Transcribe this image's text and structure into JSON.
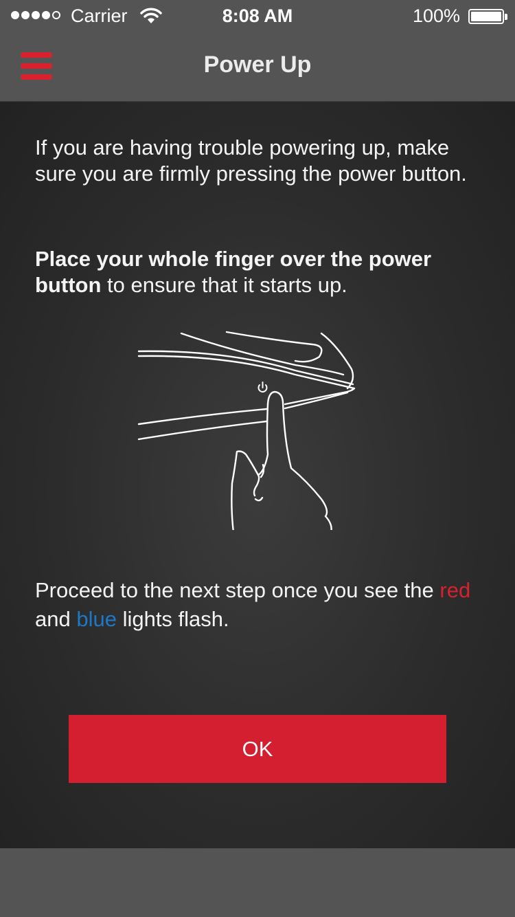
{
  "status_bar": {
    "carrier": "Carrier",
    "time": "8:08 AM",
    "battery_percent": "100%",
    "signal_bars_filled": 4,
    "signal_bars_total": 5,
    "icons": [
      "signal-icon",
      "wifi-icon",
      "battery-icon"
    ]
  },
  "nav": {
    "title": "Power Up",
    "menu_icon": "hamburger-menu-icon"
  },
  "content": {
    "paragraph1": "If you are having trouble powering up, make sure you are firmly pressing the power button.",
    "paragraph2_bold": "Place your whole finger over the power button",
    "paragraph2_rest": " to ensure that it starts up.",
    "illustration": "finger-pressing-power-button-illustration",
    "paragraph3_start": "Proceed to the next step once you see the ",
    "paragraph3_red": "red",
    "paragraph3_mid": " and ",
    "paragraph3_blue": "blue",
    "paragraph3_end": " lights flash."
  },
  "actions": {
    "ok_label": "OK"
  },
  "colors": {
    "accent_red": "#d31f2f",
    "accent_blue": "#1e78c8",
    "bar_gray": "#545454",
    "background_dark": "#2c2c2c"
  }
}
